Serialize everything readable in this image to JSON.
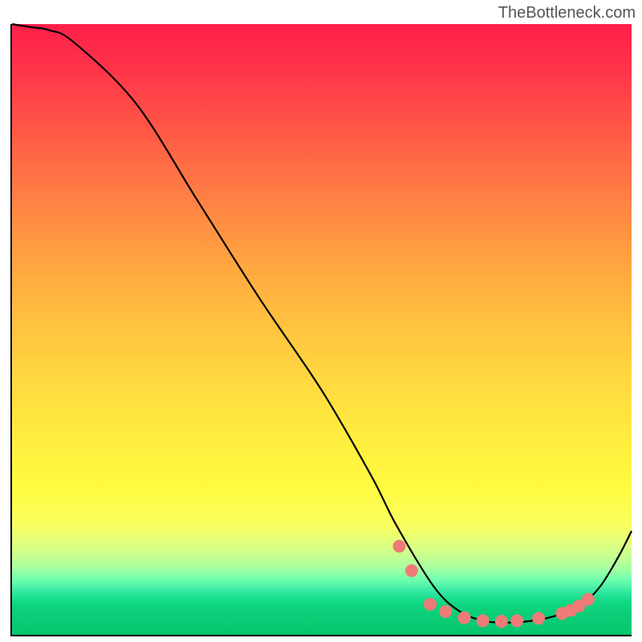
{
  "watermark": "TheBottleneck.com",
  "chart_data": {
    "type": "line",
    "title": "",
    "xlabel": "",
    "ylabel": "",
    "xlim": [
      0,
      100
    ],
    "ylim": [
      0,
      100
    ],
    "curve": {
      "x": [
        0,
        3,
        6,
        10,
        20,
        30,
        40,
        50,
        58,
        62,
        68,
        72,
        76,
        80,
        84,
        88,
        92,
        95,
        98,
        100
      ],
      "y": [
        100,
        99.5,
        99,
        97,
        87,
        71,
        55,
        40,
        26,
        18,
        8,
        4,
        2.3,
        2,
        2.3,
        3.2,
        5,
        8,
        13,
        17
      ]
    },
    "markers": {
      "x": [
        62.5,
        64.5,
        67.5,
        70,
        73,
        76,
        79,
        81.5,
        85,
        88.8,
        90.2,
        91.5,
        93
      ],
      "y": [
        14.5,
        10.5,
        5,
        3.8,
        2.8,
        2.3,
        2.2,
        2.3,
        2.7,
        3.5,
        4.0,
        4.7,
        5.8
      ]
    },
    "marker_style": {
      "color": "#ef7a77",
      "radius": 8
    },
    "line_style": {
      "color": "#000",
      "width": 2.2
    }
  }
}
